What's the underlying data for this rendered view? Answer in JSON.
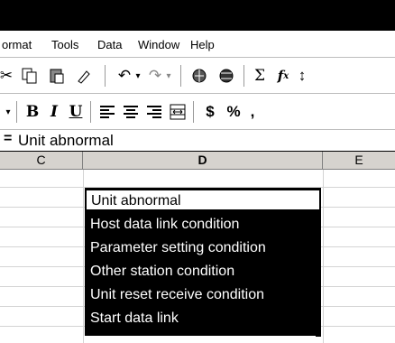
{
  "menubar": {
    "items": [
      {
        "label": "ormat"
      },
      {
        "label": "Tools"
      },
      {
        "label": "Data"
      },
      {
        "label": "Window"
      },
      {
        "label": "Help"
      }
    ]
  },
  "toolbar2": {
    "currency": "$",
    "percent": "%",
    "comma": ","
  },
  "formula_bar": {
    "content": "Unit abnormal"
  },
  "columns": [
    "C",
    "D",
    "E"
  ],
  "dropdown": {
    "items": [
      "Unit abnormal",
      "Host data link condition",
      "Parameter setting condition",
      "Other station condition",
      "Unit reset receive condition",
      "Start data link"
    ]
  }
}
